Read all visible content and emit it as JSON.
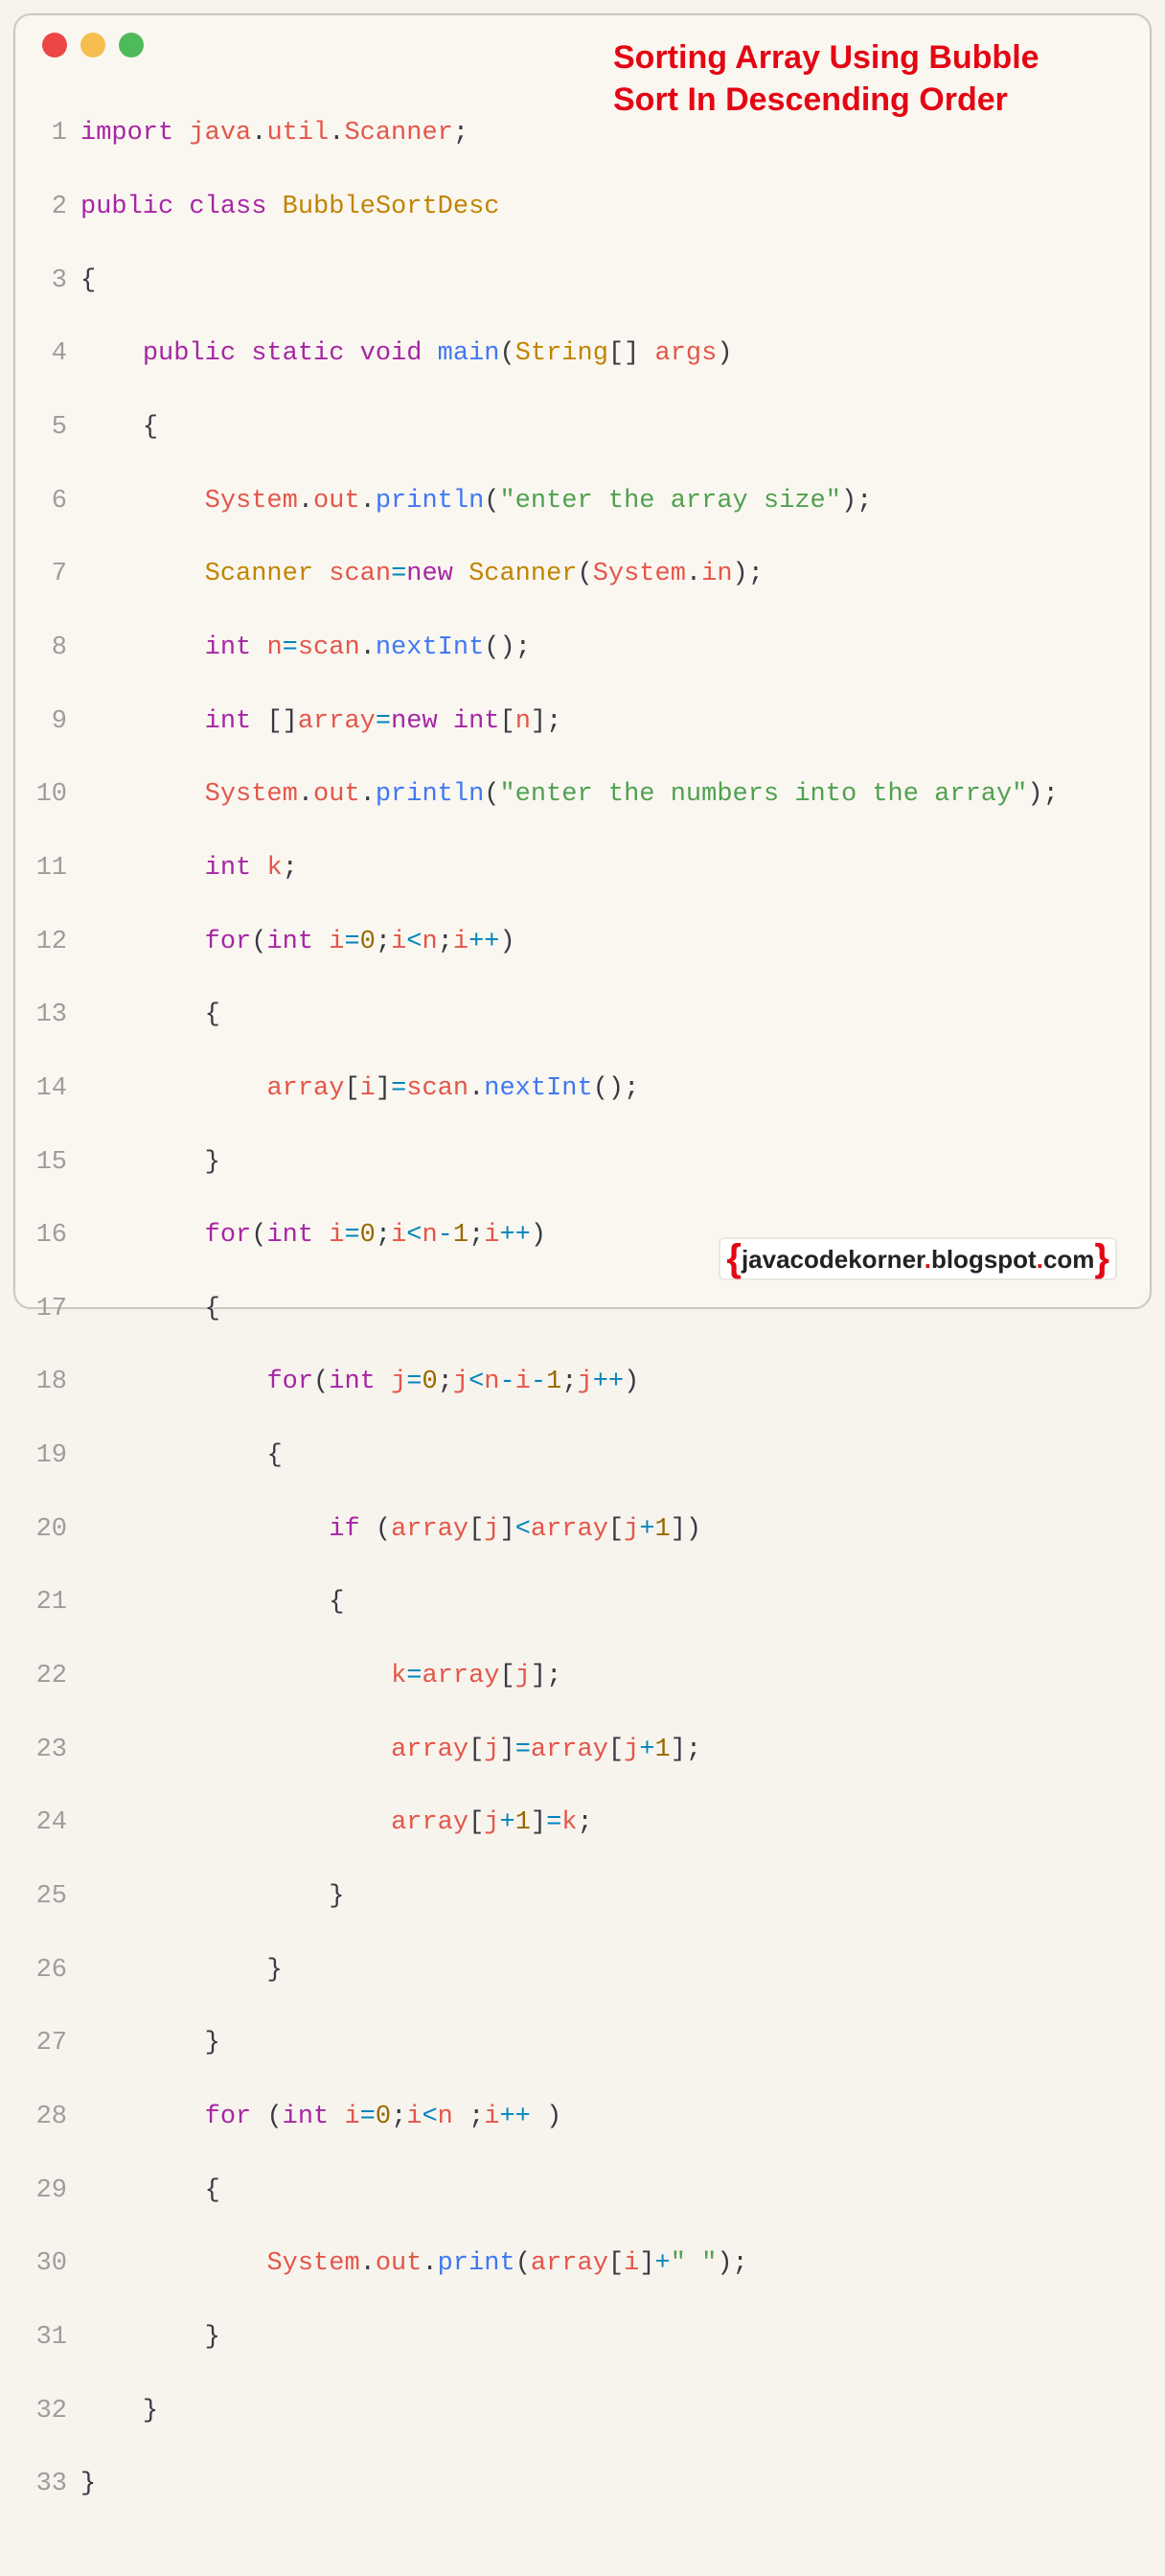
{
  "title": "Sorting Array Using Bubble Sort In Descending Order",
  "footer_left_brace": "{",
  "footer_site_a": "javacodekorner",
  "footer_site_dot1": ".",
  "footer_site_b": "blogspot",
  "footer_site_dot2": ".",
  "footer_site_c": "com",
  "footer_right_brace": "}",
  "code": {
    "line_count": 33,
    "l1": {
      "kw_import": "import",
      "pkg_a": "java",
      "dot": ".",
      "pkg_b": "util",
      "pkg_c": "Scanner",
      "semi": ";"
    },
    "l2": {
      "kw_public": "public",
      "kw_class": "class",
      "cls": "BubbleSortDesc"
    },
    "l3": {
      "brace": "{"
    },
    "l4": {
      "kw_public": "public",
      "kw_static": "static",
      "kw_void": "void",
      "fn": "main",
      "lpar": "(",
      "type": "String",
      "brkts": "[]",
      "arg": "args",
      "rpar": ")"
    },
    "l5": {
      "brace": "{"
    },
    "l6": {
      "sys": "System",
      "dot": ".",
      "out": "out",
      "dot2": ".",
      "fn": "println",
      "lpar": "(",
      "str": "\"enter the array size\"",
      "rpar": ")",
      "semi": ";"
    },
    "l7": {
      "cls": "Scanner",
      "var": "scan",
      "eq": "=",
      "kw_new": "new",
      "cls2": "Scanner",
      "lpar": "(",
      "sys": "System",
      "dot": ".",
      "in": "in",
      "rpar": ")",
      "semi": ";"
    },
    "l8": {
      "type": "int",
      "var": "n",
      "eq": "=",
      "scan": "scan",
      "dot": ".",
      "fn": "nextInt",
      "lpar": "(",
      "rpar": ")",
      "semi": ";"
    },
    "l9": {
      "type": "int",
      "brkts": "[]",
      "var": "array",
      "eq": "=",
      "kw_new": "new",
      "type2": "int",
      "lbr": "[",
      "n": "n",
      "rbr": "]",
      "semi": ";"
    },
    "l10": {
      "sys": "System",
      "dot": ".",
      "out": "out",
      "dot2": ".",
      "fn": "println",
      "lpar": "(",
      "str": "\"enter the numbers into the array\"",
      "rpar": ")",
      "semi": ";"
    },
    "l11": {
      "type": "int",
      "var": "k",
      "semi": ";"
    },
    "l12": {
      "kw_for": "for",
      "lpar": "(",
      "type": "int",
      "var": "i",
      "eq": "=",
      "num": "0",
      "semi1": ";",
      "cond_a": "i",
      "lt": "<",
      "cond_b": "n",
      "semi2": ";",
      "inc_a": "i",
      "pp": "++",
      "rpar": ")"
    },
    "l13": {
      "brace": "{"
    },
    "l14": {
      "arr": "array",
      "lbr": "[",
      "idx": "i",
      "rbr": "]",
      "eq": "=",
      "scan": "scan",
      "dot": ".",
      "fn": "nextInt",
      "lpar": "(",
      "rpar": ")",
      "semi": ";"
    },
    "l15": {
      "brace": "}"
    },
    "l16": {
      "kw_for": "for",
      "lpar": "(",
      "type": "int",
      "var": "i",
      "eq": "=",
      "num": "0",
      "semi1": ";",
      "a": "i",
      "lt": "<",
      "b": "n",
      "minus": "-",
      "one": "1",
      "semi2": ";",
      "c": "i",
      "pp": "++",
      "rpar": ")"
    },
    "l17": {
      "brace": "{"
    },
    "l18": {
      "kw_for": "for",
      "lpar": "(",
      "type": "int",
      "var": "j",
      "eq": "=",
      "num": "0",
      "semi1": ";",
      "a": "j",
      "lt": "<",
      "b": "n",
      "m1": "-",
      "c": "i",
      "m2": "-",
      "one": "1",
      "semi2": ";",
      "d": "j",
      "pp": "++",
      "rpar": ")"
    },
    "l19": {
      "brace": "{"
    },
    "l20": {
      "kw_if": "if",
      "sp": " ",
      "lpar": "(",
      "arr": "array",
      "lb1": "[",
      "j1": "j",
      "rb1": "]",
      "lt": "<",
      "arr2": "array",
      "lb2": "[",
      "j2": "j",
      "plus": "+",
      "one": "1",
      "rb2": "]",
      "rpar": ")"
    },
    "l21": {
      "brace": "{"
    },
    "l22": {
      "k": "k",
      "eq": "=",
      "arr": "array",
      "lb": "[",
      "j": "j",
      "rb": "]",
      "semi": ";"
    },
    "l23": {
      "arr": "array",
      "lb": "[",
      "j": "j",
      "rb": "]",
      "eq": "=",
      "arr2": "array",
      "lb2": "[",
      "j2": "j",
      "plus": "+",
      "one": "1",
      "rb2": "]",
      "semi": ";"
    },
    "l24": {
      "arr": "array",
      "lb": "[",
      "j": "j",
      "plus": "+",
      "one": "1",
      "rb": "]",
      "eq": "=",
      "k": "k",
      "semi": ";"
    },
    "l25": {
      "brace": "}"
    },
    "l26": {
      "brace": "}"
    },
    "l27": {
      "brace": "}"
    },
    "l28": {
      "kw_for": "for",
      "sp": " ",
      "lpar": "(",
      "type": "int",
      "var": "i",
      "eq": "=",
      "num": "0",
      "semi1": ";",
      "a": "i",
      "lt": "<",
      "b": "n",
      "sp2": " ",
      "semi2": ";",
      "c": "i",
      "pp": "++",
      "sp3": " ",
      "rpar": ")"
    },
    "l29": {
      "brace": "{"
    },
    "l30": {
      "sys": "System",
      "dot": ".",
      "out": "out",
      "dot2": ".",
      "fn": "print",
      "lpar": "(",
      "arr": "array",
      "lb": "[",
      "i": "i",
      "rb": "]",
      "plus": "+",
      "str": "\" \"",
      "rpar": ")",
      "semi": ";"
    },
    "l31": {
      "brace": "}"
    },
    "l32": {
      "brace": "}"
    },
    "l33": {
      "brace": "}"
    }
  }
}
